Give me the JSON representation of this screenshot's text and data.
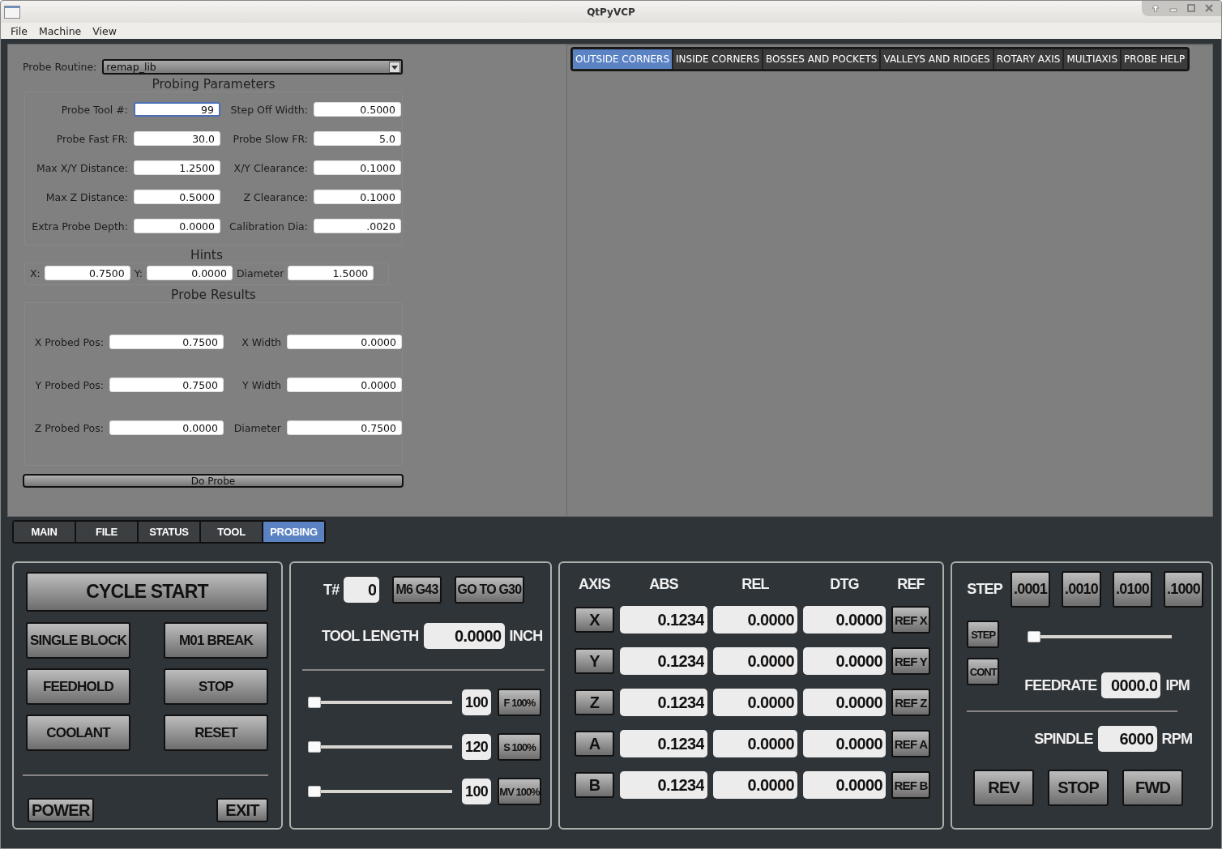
{
  "window": {
    "title": "QtPyVCP"
  },
  "menu": [
    "File",
    "Machine",
    "View"
  ],
  "probe_routine": {
    "label": "Probe Routine:",
    "value": "remap_lib"
  },
  "probing_parameters": {
    "title": "Probing Parameters",
    "fields": [
      {
        "label": "Probe Tool #:",
        "value": "99",
        "focused": true
      },
      {
        "label": "Step Off Width:",
        "value": "0.5000",
        "focused": false
      },
      {
        "label": "Probe Fast FR:",
        "value": "30.0",
        "focused": false
      },
      {
        "label": "Probe Slow FR:",
        "value": "5.0",
        "focused": false
      },
      {
        "label": "Max X/Y Distance:",
        "value": "1.2500",
        "focused": false
      },
      {
        "label": "X/Y Clearance:",
        "value": "0.1000",
        "focused": false
      },
      {
        "label": "Max Z Distance:",
        "value": "0.5000",
        "focused": false
      },
      {
        "label": "Z Clearance:",
        "value": "0.1000",
        "focused": false
      },
      {
        "label": "Extra Probe Depth:",
        "value": "0.0000",
        "focused": false
      },
      {
        "label": "Calibration Dia:",
        "value": ".0020",
        "focused": false
      }
    ]
  },
  "hints": {
    "title": "Hints",
    "fields": [
      {
        "label": "X:",
        "value": "0.7500"
      },
      {
        "label": "Y:",
        "value": "0.0000"
      },
      {
        "label": "Diameter",
        "value": "1.5000"
      }
    ]
  },
  "probe_results": {
    "title": "Probe Results",
    "fields": [
      {
        "label": "X Probed Pos:",
        "value": "0.7500"
      },
      {
        "label": "X Width",
        "value": "0.0000"
      },
      {
        "label": "Y Probed Pos:",
        "value": "0.7500"
      },
      {
        "label": "Y Width",
        "value": "0.0000"
      },
      {
        "label": "Z Probed Pos:",
        "value": "0.0000"
      },
      {
        "label": "Diameter",
        "value": "0.7500"
      }
    ]
  },
  "do_probe_button": "Do Probe",
  "probe_tabs": [
    {
      "label": "OUTSIDE CORNERS",
      "selected": true
    },
    {
      "label": "INSIDE CORNERS",
      "selected": false
    },
    {
      "label": "BOSSES AND POCKETS",
      "selected": false
    },
    {
      "label": "VALLEYS AND RIDGES",
      "selected": false
    },
    {
      "label": "ROTARY AXIS",
      "selected": false
    },
    {
      "label": "MULTIAXIS",
      "selected": false
    },
    {
      "label": "PROBE HELP",
      "selected": false
    }
  ],
  "main_tabs": [
    {
      "label": "MAIN",
      "selected": false
    },
    {
      "label": "FILE",
      "selected": false
    },
    {
      "label": "STATUS",
      "selected": false
    },
    {
      "label": "TOOL",
      "selected": false
    },
    {
      "label": "PROBING",
      "selected": true
    }
  ],
  "program_control": {
    "cycle_start": "CYCLE START",
    "buttons": [
      "SINGLE BLOCK",
      "M01 BREAK",
      "FEEDHOLD",
      "STOP",
      "COOLANT",
      "RESET"
    ],
    "power": "POWER",
    "exit": "EXIT"
  },
  "tool": {
    "tool_label": "T#",
    "tool_number": "0",
    "buttons": [
      "M6 G43",
      "GO TO G30"
    ],
    "length_label": "TOOL LENGTH",
    "length_value": "0.0000",
    "length_unit": "INCH"
  },
  "overrides": [
    {
      "value": "100",
      "button": "F 100%",
      "level": 0
    },
    {
      "value": "120",
      "button": "S 100%",
      "level": 0
    },
    {
      "value": "100",
      "button": "MV 100%",
      "level": 0
    }
  ],
  "axes": {
    "columns": [
      "AXIS",
      "ABS",
      "REL",
      "DTG",
      "REF"
    ],
    "rows": [
      {
        "axis": "X",
        "abs": "0.1234",
        "rel": "0.0000",
        "dtg": "0.0000",
        "ref": "REF X"
      },
      {
        "axis": "Y",
        "abs": "0.1234",
        "rel": "0.0000",
        "dtg": "0.0000",
        "ref": "REF Y"
      },
      {
        "axis": "Z",
        "abs": "0.1234",
        "rel": "0.0000",
        "dtg": "0.0000",
        "ref": "REF Z"
      },
      {
        "axis": "A",
        "abs": "0.1234",
        "rel": "0.0000",
        "dtg": "0.0000",
        "ref": "REF A"
      },
      {
        "axis": "B",
        "abs": "0.1234",
        "rel": "0.0000",
        "dtg": "0.0000",
        "ref": "REF B"
      }
    ]
  },
  "jog": {
    "step_label": "STEP",
    "steps": [
      ".0001",
      ".0010",
      ".0100",
      ".1000"
    ],
    "modes": [
      "STEP",
      "CONT"
    ],
    "level": 0,
    "feedrate_label": "FEEDRATE",
    "feedrate_value": "0000.0",
    "feedrate_unit": "IPM"
  },
  "spindle": {
    "label": "SPINDLE",
    "value": "6000",
    "unit": "RPM",
    "buttons": [
      "REV",
      "STOP",
      "FWD"
    ]
  }
}
